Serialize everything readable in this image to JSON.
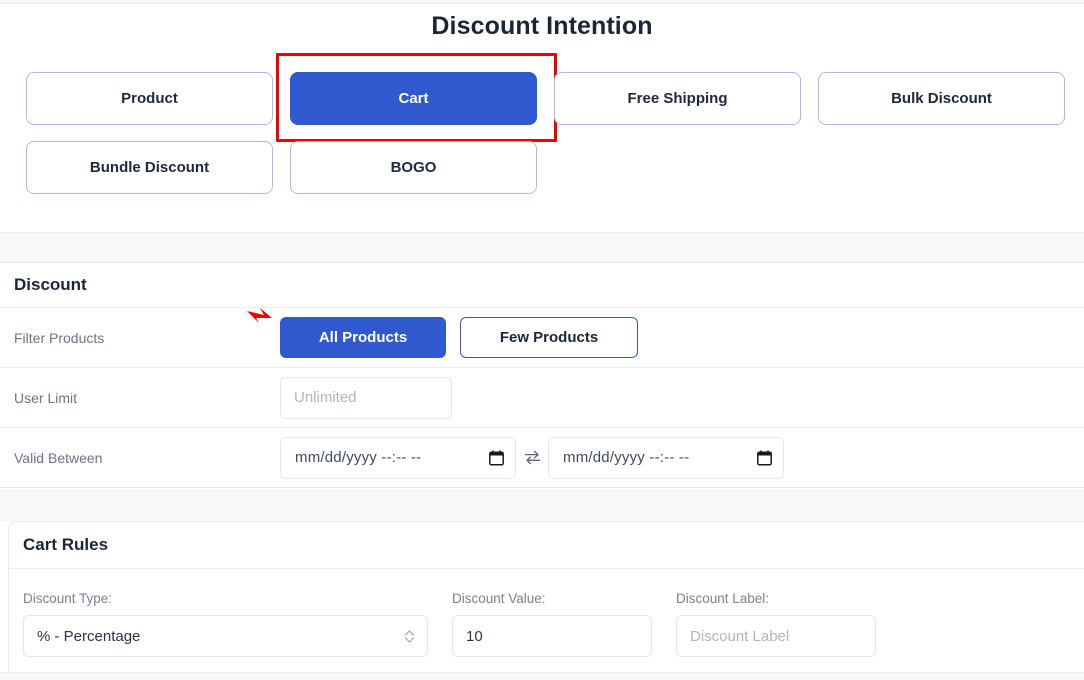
{
  "page_title": "Discount Intention",
  "colors": {
    "primary": "#3059d0",
    "highlight": "#f40000",
    "cursor": "#f40000",
    "outline_border": "#aab9e9",
    "label_text": "#6b7385"
  },
  "intentions": {
    "rows": [
      [
        {
          "label": "Product",
          "selected": false,
          "highlighted": false
        },
        {
          "label": "Cart",
          "selected": true,
          "highlighted": true
        },
        {
          "label": "Free Shipping",
          "selected": false,
          "highlighted": false
        },
        {
          "label": "Bulk Discount",
          "selected": false,
          "highlighted": false
        }
      ],
      [
        {
          "label": "Bundle Discount",
          "selected": false,
          "highlighted": false
        },
        {
          "label": "BOGO",
          "selected": false,
          "highlighted": false
        }
      ]
    ]
  },
  "discount": {
    "heading": "Discount",
    "filter_products": {
      "label": "Filter Products",
      "all_label": "All Products",
      "few_label": "Few Products",
      "selected": "All Products"
    },
    "user_limit": {
      "label": "User Limit",
      "value": "",
      "placeholder": "Unlimited"
    },
    "valid_between": {
      "label": "Valid Between",
      "start_value": "",
      "start_placeholder": "mm/dd/yyyy --:-- --",
      "end_value": "",
      "end_placeholder": "mm/dd/yyyy --:-- --",
      "swap_icon": "swap-horizontal-icon",
      "calendar_icon": "calendar-icon"
    }
  },
  "cart_rules": {
    "heading": "Cart Rules",
    "discount_type": {
      "label": "Discount Type:",
      "value": "% - Percentage"
    },
    "discount_value": {
      "label": "Discount Value:",
      "value": "10",
      "placeholder": ""
    },
    "discount_label": {
      "label": "Discount Label:",
      "value": "",
      "placeholder": "Discount Label"
    }
  }
}
